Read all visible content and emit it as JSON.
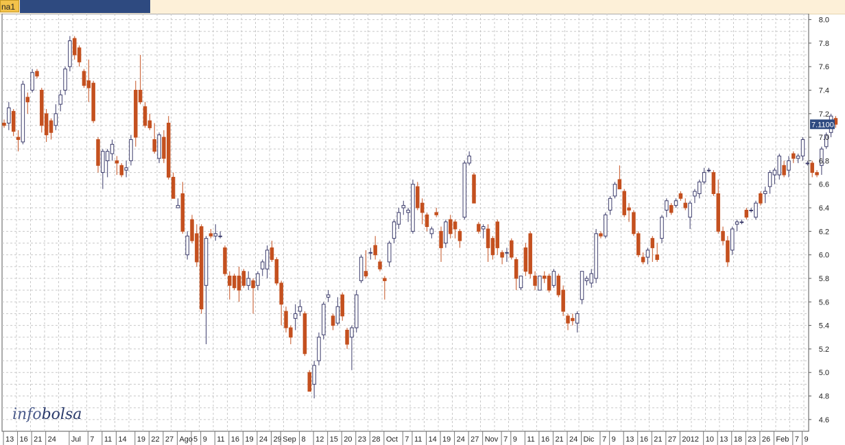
{
  "header": {
    "tab_label": "na1"
  },
  "watermark": {
    "part1": "info",
    "part2": "bolsa"
  },
  "colors": {
    "bull_fill": "#ffffff",
    "bull_stroke": "#3a3a6a",
    "bear": "#c4501f",
    "grid": "#c8c8c8",
    "last_bg": "#2e4a80"
  },
  "chart_data": {
    "type": "candlestick",
    "ylim": [
      4.5,
      8.05
    ],
    "y_ticks": [
      "4.6",
      "4.8",
      "5.0",
      "5.2",
      "5.4",
      "5.6",
      "5.8",
      "6.0",
      "6.2",
      "6.4",
      "6.6",
      "6.8",
      "7.0",
      "7.2",
      "7.4",
      "7.6",
      "7.8",
      "8.0"
    ],
    "last_value": "7.1100",
    "grid": true,
    "x_labels": [
      {
        "i": 0,
        "t": "13"
      },
      {
        "i": 3,
        "t": "16"
      },
      {
        "i": 6,
        "t": "21"
      },
      {
        "i": 9,
        "t": "24"
      },
      {
        "i": 14,
        "t": "Jul"
      },
      {
        "i": 18,
        "t": "7"
      },
      {
        "i": 21,
        "t": "11"
      },
      {
        "i": 24,
        "t": "14"
      },
      {
        "i": 28,
        "t": "19"
      },
      {
        "i": 31,
        "t": "22"
      },
      {
        "i": 34,
        "t": "27"
      },
      {
        "i": 37,
        "t": "Ago"
      },
      {
        "i": 40,
        "t": "5"
      },
      {
        "i": 42,
        "t": "9"
      },
      {
        "i": 45,
        "t": "11"
      },
      {
        "i": 48,
        "t": "16"
      },
      {
        "i": 51,
        "t": "19"
      },
      {
        "i": 54,
        "t": "24"
      },
      {
        "i": 57,
        "t": "29"
      },
      {
        "i": 59,
        "t": "Sep"
      },
      {
        "i": 63,
        "t": "8"
      },
      {
        "i": 66,
        "t": "12"
      },
      {
        "i": 69,
        "t": "15"
      },
      {
        "i": 72,
        "t": "20"
      },
      {
        "i": 75,
        "t": "23"
      },
      {
        "i": 78,
        "t": "28"
      },
      {
        "i": 81,
        "t": "Oct"
      },
      {
        "i": 85,
        "t": "7"
      },
      {
        "i": 87,
        "t": "11"
      },
      {
        "i": 90,
        "t": "14"
      },
      {
        "i": 93,
        "t": "19"
      },
      {
        "i": 96,
        "t": "24"
      },
      {
        "i": 99,
        "t": "27"
      },
      {
        "i": 102,
        "t": "Nov"
      },
      {
        "i": 106,
        "t": "7"
      },
      {
        "i": 108,
        "t": "9"
      },
      {
        "i": 111,
        "t": "11"
      },
      {
        "i": 114,
        "t": "16"
      },
      {
        "i": 117,
        "t": "21"
      },
      {
        "i": 120,
        "t": "24"
      },
      {
        "i": 123,
        "t": "Dic"
      },
      {
        "i": 127,
        "t": "7"
      },
      {
        "i": 129,
        "t": "9"
      },
      {
        "i": 132,
        "t": "13"
      },
      {
        "i": 135,
        "t": "16"
      },
      {
        "i": 138,
        "t": "21"
      },
      {
        "i": 141,
        "t": "27"
      },
      {
        "i": 144,
        "t": "2012"
      },
      {
        "i": 149,
        "t": "10"
      },
      {
        "i": 152,
        "t": "13"
      },
      {
        "i": 155,
        "t": "18"
      },
      {
        "i": 158,
        "t": "23"
      },
      {
        "i": 161,
        "t": "26"
      },
      {
        "i": 164,
        "t": "Feb"
      },
      {
        "i": 168,
        "t": "7"
      },
      {
        "i": 170,
        "t": "9"
      }
    ],
    "ohlc": [
      [
        7.12,
        7.15,
        7.08,
        7.1
      ],
      [
        7.12,
        7.3,
        7.06,
        7.25
      ],
      [
        7.22,
        7.24,
        7.01,
        7.05
      ],
      [
        7.0,
        7.06,
        6.88,
        6.98
      ],
      [
        6.96,
        7.48,
        6.94,
        7.45
      ],
      [
        7.34,
        7.38,
        7.2,
        7.3
      ],
      [
        7.4,
        7.58,
        7.38,
        7.55
      ],
      [
        7.56,
        7.58,
        7.5,
        7.52
      ],
      [
        7.4,
        7.42,
        7.04,
        7.1
      ],
      [
        7.2,
        7.24,
        6.96,
        7.02
      ],
      [
        7.14,
        7.16,
        6.98,
        7.04
      ],
      [
        7.1,
        7.28,
        7.06,
        7.2
      ],
      [
        7.28,
        7.4,
        7.22,
        7.36
      ],
      [
        7.4,
        7.6,
        7.36,
        7.58
      ],
      [
        7.6,
        7.86,
        7.56,
        7.82
      ],
      [
        7.84,
        7.86,
        7.66,
        7.7
      ],
      [
        7.76,
        7.78,
        7.6,
        7.64
      ],
      [
        7.56,
        7.58,
        7.42,
        7.44
      ],
      [
        7.48,
        7.66,
        7.3,
        7.42
      ],
      [
        7.46,
        7.48,
        7.12,
        7.14
      ],
      [
        6.98,
        7.0,
        6.7,
        6.76
      ],
      [
        6.7,
        6.9,
        6.56,
        6.88
      ],
      [
        6.8,
        6.9,
        6.66,
        6.88
      ],
      [
        6.86,
        6.98,
        6.8,
        6.94
      ],
      [
        6.8,
        6.84,
        6.68,
        6.78
      ],
      [
        6.76,
        6.78,
        6.66,
        6.68
      ],
      [
        6.72,
        6.8,
        6.66,
        6.74
      ],
      [
        6.8,
        7.02,
        6.76,
        6.98
      ],
      [
        7.4,
        7.48,
        6.92,
        7.0
      ],
      [
        7.4,
        7.7,
        7.28,
        7.3
      ],
      [
        7.26,
        7.3,
        7.08,
        7.1
      ],
      [
        7.14,
        7.2,
        7.06,
        7.08
      ],
      [
        6.98,
        7.12,
        6.86,
        6.88
      ],
      [
        6.82,
        7.04,
        6.78,
        7.02
      ],
      [
        7.0,
        7.06,
        6.78,
        6.82
      ],
      [
        7.12,
        7.18,
        6.64,
        6.66
      ],
      [
        6.66,
        6.7,
        6.48,
        6.48
      ],
      [
        6.4,
        6.48,
        6.4,
        6.42
      ],
      [
        6.52,
        6.62,
        6.18,
        6.2
      ],
      [
        6.0,
        6.2,
        5.96,
        6.16
      ],
      [
        6.3,
        6.34,
        6.1,
        6.12
      ],
      [
        6.18,
        6.26,
        5.9,
        5.94
      ],
      [
        6.24,
        6.26,
        5.5,
        5.54
      ],
      [
        5.74,
        6.16,
        5.24,
        6.14
      ],
      [
        6.18,
        6.22,
        6.14,
        6.16
      ],
      [
        6.16,
        6.26,
        6.12,
        6.18
      ],
      [
        6.16,
        6.2,
        6.14,
        6.16
      ],
      [
        6.06,
        6.08,
        5.82,
        5.84
      ],
      [
        5.82,
        5.86,
        5.62,
        5.74
      ],
      [
        5.82,
        5.84,
        5.7,
        5.72
      ],
      [
        5.82,
        5.9,
        5.6,
        5.7
      ],
      [
        5.86,
        5.88,
        5.72,
        5.74
      ],
      [
        5.74,
        5.86,
        5.7,
        5.8
      ],
      [
        5.78,
        5.8,
        5.5,
        5.72
      ],
      [
        5.74,
        5.86,
        5.7,
        5.84
      ],
      [
        5.88,
        5.96,
        5.82,
        5.94
      ],
      [
        5.88,
        6.08,
        5.8,
        6.04
      ],
      [
        6.06,
        6.12,
        5.94,
        5.96
      ],
      [
        5.96,
        5.98,
        5.74,
        5.76
      ],
      [
        5.76,
        5.78,
        5.4,
        5.58
      ],
      [
        5.52,
        5.56,
        5.34,
        5.38
      ],
      [
        5.38,
        5.4,
        5.24,
        5.3
      ],
      [
        5.46,
        5.58,
        5.36,
        5.5
      ],
      [
        5.52,
        5.62,
        5.48,
        5.56
      ],
      [
        5.5,
        5.52,
        5.14,
        5.16
      ],
      [
        5.0,
        5.02,
        4.84,
        4.84
      ],
      [
        4.9,
        5.1,
        4.78,
        5.06
      ],
      [
        5.1,
        5.34,
        5.06,
        5.3
      ],
      [
        5.32,
        5.6,
        5.28,
        5.58
      ],
      [
        5.64,
        5.7,
        5.6,
        5.66
      ],
      [
        5.48,
        5.5,
        5.36,
        5.4
      ],
      [
        5.42,
        5.64,
        5.4,
        5.56
      ],
      [
        5.66,
        5.68,
        5.44,
        5.48
      ],
      [
        5.36,
        5.38,
        5.2,
        5.24
      ],
      [
        5.3,
        5.4,
        5.02,
        5.38
      ],
      [
        5.38,
        5.7,
        5.34,
        5.66
      ],
      [
        5.78,
        6.0,
        5.76,
        5.98
      ],
      [
        5.86,
        6.04,
        5.8,
        5.82
      ],
      [
        6.02,
        6.06,
        5.96,
        6.02
      ],
      [
        6.08,
        6.16,
        5.96,
        6.0
      ],
      [
        5.94,
        5.96,
        5.86,
        5.88
      ],
      [
        5.8,
        5.82,
        5.62,
        5.78
      ],
      [
        5.94,
        6.12,
        5.9,
        6.1
      ],
      [
        6.14,
        6.3,
        6.1,
        6.28
      ],
      [
        6.26,
        6.4,
        6.22,
        6.36
      ],
      [
        6.4,
        6.46,
        6.34,
        6.42
      ],
      [
        6.36,
        6.4,
        6.28,
        6.38
      ],
      [
        6.2,
        6.64,
        6.18,
        6.6
      ],
      [
        6.58,
        6.62,
        6.38,
        6.4
      ],
      [
        6.44,
        6.48,
        6.26,
        6.36
      ],
      [
        6.34,
        6.36,
        6.2,
        6.24
      ],
      [
        6.18,
        6.24,
        6.14,
        6.22
      ],
      [
        6.36,
        6.4,
        6.32,
        6.34
      ],
      [
        6.2,
        6.24,
        5.94,
        6.06
      ],
      [
        6.1,
        6.3,
        6.06,
        6.28
      ],
      [
        6.3,
        6.34,
        6.14,
        6.18
      ],
      [
        6.28,
        6.3,
        6.14,
        6.22
      ],
      [
        6.2,
        6.22,
        6.06,
        6.12
      ],
      [
        6.32,
        6.8,
        6.3,
        6.78
      ],
      [
        6.78,
        6.88,
        6.76,
        6.84
      ],
      [
        6.68,
        6.7,
        6.44,
        6.44
      ],
      [
        6.26,
        6.28,
        6.18,
        6.2
      ],
      [
        6.22,
        6.26,
        6.14,
        6.24
      ],
      [
        6.22,
        6.26,
        5.94,
        6.06
      ],
      [
        6.14,
        6.16,
        5.96,
        6.0
      ],
      [
        6.28,
        6.3,
        6.0,
        6.06
      ],
      [
        6.02,
        6.04,
        5.92,
        5.98
      ],
      [
        6.02,
        6.06,
        5.94,
        6.02
      ],
      [
        6.12,
        6.14,
        5.96,
        5.98
      ],
      [
        5.96,
        5.98,
        5.7,
        5.8
      ],
      [
        5.72,
        5.82,
        5.7,
        5.82
      ],
      [
        6.06,
        6.1,
        5.82,
        5.86
      ],
      [
        6.18,
        6.2,
        5.8,
        5.84
      ],
      [
        5.82,
        5.86,
        5.7,
        5.74
      ],
      [
        5.7,
        5.82,
        5.7,
        5.82
      ],
      [
        5.82,
        5.86,
        5.76,
        5.8
      ],
      [
        5.82,
        5.84,
        5.68,
        5.7
      ],
      [
        5.74,
        5.88,
        5.72,
        5.86
      ],
      [
        5.82,
        5.84,
        5.64,
        5.66
      ],
      [
        5.7,
        5.74,
        5.48,
        5.52
      ],
      [
        5.48,
        5.5,
        5.36,
        5.42
      ],
      [
        5.46,
        5.5,
        5.4,
        5.44
      ],
      [
        5.42,
        5.52,
        5.34,
        5.5
      ],
      [
        5.62,
        5.86,
        5.58,
        5.86
      ],
      [
        5.78,
        5.82,
        5.74,
        5.8
      ],
      [
        5.76,
        5.88,
        5.72,
        5.84
      ],
      [
        5.8,
        6.22,
        5.76,
        6.18
      ],
      [
        6.18,
        6.2,
        6.14,
        6.16
      ],
      [
        6.16,
        6.36,
        6.14,
        6.34
      ],
      [
        6.38,
        6.5,
        6.34,
        6.48
      ],
      [
        6.5,
        6.62,
        6.48,
        6.6
      ],
      [
        6.64,
        6.76,
        6.56,
        6.56
      ],
      [
        6.54,
        6.56,
        6.32,
        6.34
      ],
      [
        6.4,
        6.44,
        6.28,
        6.38
      ],
      [
        6.36,
        6.38,
        6.16,
        6.18
      ],
      [
        6.18,
        6.2,
        5.98,
        6.0
      ],
      [
        5.98,
        6.02,
        5.92,
        5.94
      ],
      [
        5.98,
        6.06,
        5.92,
        6.04
      ],
      [
        6.14,
        6.16,
        5.94,
        6.06
      ],
      [
        6.0,
        6.1,
        5.94,
        5.96
      ],
      [
        6.14,
        6.34,
        6.1,
        6.32
      ],
      [
        6.38,
        6.48,
        6.32,
        6.46
      ],
      [
        6.42,
        6.44,
        6.34,
        6.36
      ],
      [
        6.42,
        6.48,
        6.4,
        6.46
      ],
      [
        6.52,
        6.54,
        6.46,
        6.48
      ],
      [
        6.44,
        6.48,
        6.38,
        6.4
      ],
      [
        6.32,
        6.46,
        6.22,
        6.44
      ],
      [
        6.5,
        6.56,
        6.44,
        6.54
      ],
      [
        6.52,
        6.64,
        6.48,
        6.62
      ],
      [
        6.62,
        6.74,
        6.6,
        6.7
      ],
      [
        6.72,
        6.74,
        6.7,
        6.72
      ],
      [
        6.7,
        6.72,
        6.5,
        6.52
      ],
      [
        6.52,
        6.64,
        6.18,
        6.2
      ],
      [
        6.2,
        6.24,
        6.08,
        6.12
      ],
      [
        6.12,
        6.16,
        5.9,
        5.94
      ],
      [
        6.04,
        6.24,
        6.0,
        6.22
      ],
      [
        6.26,
        6.3,
        6.2,
        6.28
      ],
      [
        6.28,
        6.3,
        6.26,
        6.28
      ],
      [
        6.38,
        6.4,
        6.3,
        6.32
      ],
      [
        6.38,
        6.4,
        6.36,
        6.38
      ],
      [
        6.32,
        6.46,
        6.3,
        6.44
      ],
      [
        6.52,
        6.54,
        6.42,
        6.44
      ],
      [
        6.52,
        6.58,
        6.44,
        6.54
      ],
      [
        6.58,
        6.72,
        6.52,
        6.7
      ],
      [
        6.68,
        6.74,
        6.6,
        6.72
      ],
      [
        6.68,
        6.86,
        6.64,
        6.84
      ],
      [
        6.76,
        6.8,
        6.66,
        6.68
      ],
      [
        6.72,
        6.84,
        6.66,
        6.8
      ],
      [
        6.86,
        6.88,
        6.78,
        6.82
      ],
      [
        6.82,
        6.86,
        6.78,
        6.84
      ],
      [
        6.84,
        7.0,
        6.8,
        6.98
      ],
      [
        6.78,
        6.8,
        6.76,
        6.78
      ],
      [
        6.78,
        6.8,
        6.66,
        6.7
      ],
      [
        6.7,
        6.72,
        6.66,
        6.68
      ],
      [
        6.76,
        6.92,
        6.68,
        6.9
      ],
      [
        6.92,
        7.04,
        6.9,
        7.02
      ],
      [
        7.04,
        7.2,
        7.0,
        7.18
      ],
      [
        7.16,
        7.18,
        7.08,
        7.11
      ]
    ]
  }
}
